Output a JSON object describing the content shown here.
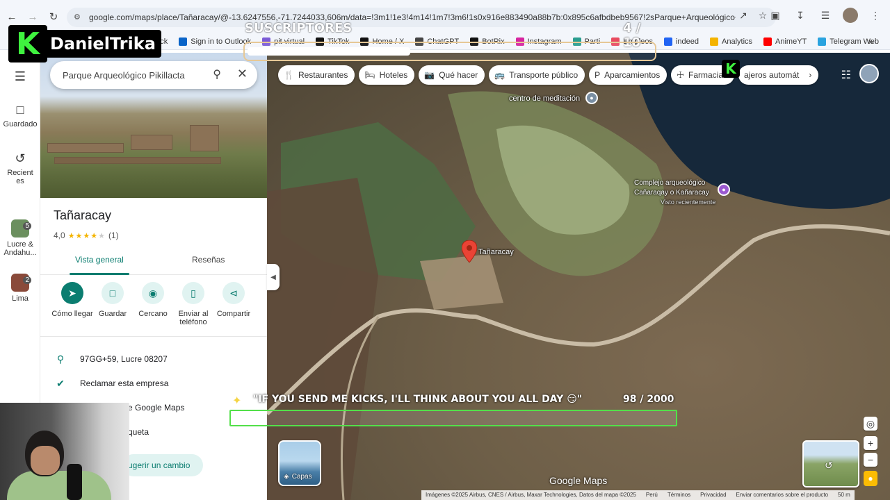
{
  "browser": {
    "url": "google.com/maps/place/Tañaracay/@-13.6247556,-71.7244033,606m/data=!3m1!1e3!4m14!1m7!3m6!1s0x916e883490a88b7b:0x895c6afbdbeb9567!2sParque+Arqueológico+Pikillacta!...",
    "bookmarks": [
      {
        "label": "Kick",
        "color": "#53fc18"
      },
      {
        "label": "Sign in to Outlook",
        "color": "#0a64c8"
      },
      {
        "label": "pit virtual",
        "color": "#7b5bd6"
      },
      {
        "label": "TikTok",
        "color": "#111111"
      },
      {
        "label": "Home / X",
        "color": "#111111"
      },
      {
        "label": "ChatGPT",
        "color": "#444444"
      },
      {
        "label": "BotRix",
        "color": "#111111"
      },
      {
        "label": "Instagram",
        "color": "#d6249f"
      },
      {
        "label": "Parti",
        "color": "#2a9d8f"
      },
      {
        "label": "Empleos",
        "color": "#e84a5f"
      },
      {
        "label": "indeed",
        "color": "#2164f3"
      },
      {
        "label": "Analytics",
        "color": "#f4b400"
      },
      {
        "label": "AnimeYT",
        "color": "#ff0000"
      },
      {
        "label": "Telegram Web",
        "color": "#2aa3df"
      }
    ]
  },
  "rail": {
    "saved": "Guardado",
    "recent": "Recientes",
    "recent_items": [
      {
        "label": "Lucre & Andahu...",
        "count": "5"
      },
      {
        "label": "Lima",
        "count": "2"
      }
    ]
  },
  "panel": {
    "search_value": "Parque Arqueológico Pikillacta",
    "place_name": "Tañaracay",
    "rating_value": "4,0",
    "rating_count": "(1)",
    "rating_stars": 4,
    "tabs": [
      "Vista general",
      "Reseñas"
    ],
    "actions": [
      "Cómo llegar",
      "Guardar",
      "Cercano",
      "Enviar al teléfono",
      "Compartir"
    ],
    "address": "97GG+59, Lucre 08207",
    "claim": "Reclamar esta empresa",
    "maps_row": "e Google Maps",
    "label_row": "queta",
    "suggest": "ugerir un cambio"
  },
  "map": {
    "chips": [
      "Restaurantes",
      "Hoteles",
      "Qué hacer",
      "Transporte público",
      "Aparcamientos",
      "Farmacias",
      "ajeros automát"
    ],
    "labels": {
      "meditation": "centro de meditación",
      "complex_1": "Complejo arqueológico",
      "complex_2": "Cañaraqay o Kañaracay",
      "recently_viewed": "Visto recientemente",
      "pin_label": "Tañaracay"
    },
    "layers": "Capas",
    "logo": "Google Maps",
    "footer": [
      "Imágenes ©2025 Airbus, CNES / Airbus, Maxar Technologies, Datos del mapa ©2025",
      "Perú",
      "Términos",
      "Privacidad",
      "Enviar comentarios sobre el producto",
      "50 m"
    ]
  },
  "overlay": {
    "brand": "DanielTrika",
    "subs_label": "SUSCRIPTORES",
    "subs_count": "4 / 10",
    "subs_progress": 0.4,
    "kicks_msg": "\"IF YOU SEND ME KICKS, I'LL THINK ABOUT YOU ALL DAY 😏\"",
    "kicks_count": "98 / 2000",
    "kicks_progress": 0.049
  },
  "colors": {
    "accent": "#0b7d70",
    "kick_green": "#53fc18",
    "star": "#f4b400"
  }
}
